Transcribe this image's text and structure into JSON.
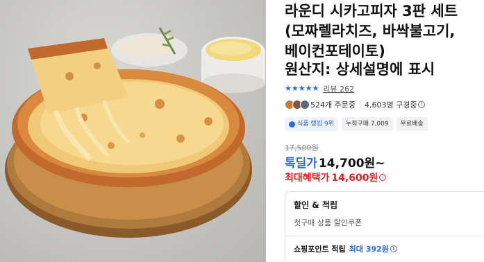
{
  "product": {
    "title_line1": "라운디 시카고피자 3판 세트",
    "title_line2": "(모짜렐라치즈, 바싹불고기,",
    "title_line3": "베이컨포테이토)",
    "origin": "원산지: 상세설명에 표시"
  },
  "rating": {
    "stars": 5,
    "review_label": "리뷰 262"
  },
  "buyers": {
    "orders": "524개 주문중",
    "subscribers": "4,603명 구경중"
  },
  "badges": {
    "rank": "식품 랭킹 9위",
    "cumulative": "누적구매 7,009",
    "shipping": "무료배송"
  },
  "pricing": {
    "original": "17,500원",
    "deal_label": "톡딜가",
    "deal_price": "14,700원~",
    "max_label": "최대혜택가",
    "max_price": "14,600원"
  },
  "benefits": {
    "title": "할인 & 적립",
    "coupon": "첫구매 상품 할인쿠폰",
    "points_label": "쇼핑포인트 적립",
    "points_value": "최대 392원"
  },
  "colors": {
    "accent_blue": "#2c6bdf",
    "accent_red": "#e02020"
  }
}
